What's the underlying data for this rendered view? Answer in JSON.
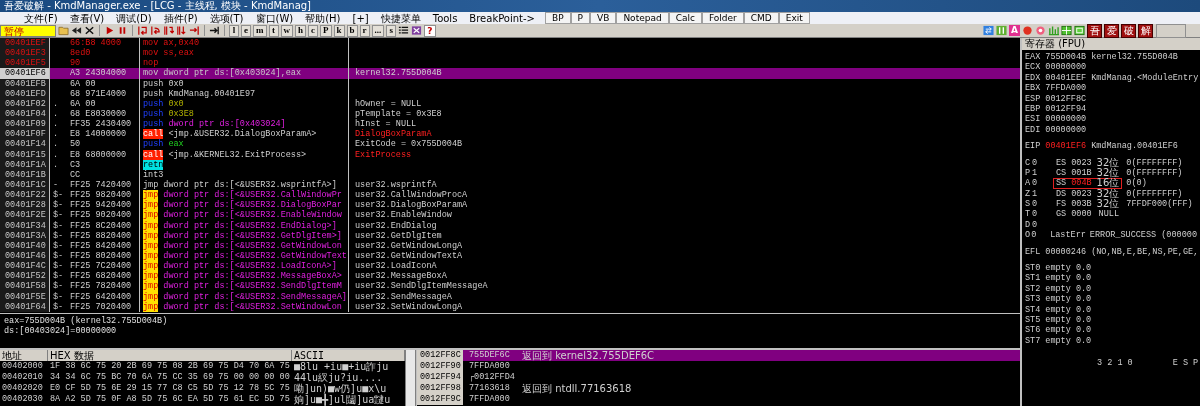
{
  "window": {
    "title": "吾爱破解 - KmdManager.exe - [LCG - 主线程, 模块 - KmdManag]"
  },
  "menu": [
    "文件(F)",
    "查看(V)",
    "调试(D)",
    "插件(P)",
    "选项(T)",
    "窗口(W)",
    "帮助(H)",
    "[+]",
    "快捷菜单",
    "Tools",
    "BreakPoint->"
  ],
  "quick_buttons": [
    "BP",
    "P",
    "VB",
    "Notepad",
    "Calc",
    "Folder",
    "CMD",
    "Exit"
  ],
  "toolbar": {
    "status": "暂停",
    "letters": [
      "l",
      "e",
      "m",
      "t",
      "w",
      "h",
      "c",
      "P",
      "k",
      "b",
      "r",
      "...",
      "s"
    ],
    "help": "?",
    "font_icon": "A",
    "brand": [
      "吾",
      "爱",
      "破",
      "解"
    ]
  },
  "disassembly": [
    {
      "addr": "00401EEF",
      "hex": "66:B8 4000",
      "mnem": "mov",
      "kind": "plain",
      "ops": {
        "text": "ax,0x40",
        "kind": "plain"
      },
      "modified": true,
      "selected": false
    },
    {
      "addr": "00401EF3",
      "hex": "8ed0",
      "mnem": "mov",
      "kind": "plain",
      "ops": {
        "text": "ss,eax",
        "kind": "plain"
      },
      "modified": true,
      "selected": false
    },
    {
      "addr": "00401EF5",
      "hex": "90",
      "mnem": "nop",
      "kind": "plain",
      "modified": true,
      "selected": false
    },
    {
      "addr": "00401EF6",
      "hex": "A3 24304000",
      "mnem": "mov",
      "kind": "plain",
      "ops": {
        "text": "dword ptr ds:[0x403024],eax",
        "kind": "plain"
      },
      "modified": false,
      "selected": true,
      "comment": {
        "text": "kernel32.755D004B",
        "kind": "plain"
      }
    },
    {
      "addr": "00401EFB",
      "hex": "6A 00",
      "mnem": "push",
      "kind": "plain",
      "ops": {
        "text": "0x0",
        "kind": "plain"
      },
      "modified": false,
      "selected": false
    },
    {
      "addr": "00401EFD",
      "hex": "68 971E4000",
      "mnem": "push",
      "kind": "plain",
      "ops": {
        "text": "KmdManag.00401E97",
        "kind": "plain"
      },
      "modified": false,
      "selected": false
    },
    {
      "addr": "00401F02",
      "mark": ".",
      "hex": "6A 00",
      "mnem": "push",
      "kind": "push",
      "ops": {
        "text": "0x0",
        "kind": "imm"
      },
      "modified": false,
      "selected": false,
      "comment": {
        "text": "hOwner = NULL",
        "kind": "plain"
      }
    },
    {
      "addr": "00401F04",
      "mark": ".",
      "hex": "68 E8030000",
      "mnem": "push",
      "kind": "push",
      "ops": {
        "text": "0x3E8",
        "kind": "imm"
      },
      "modified": false,
      "selected": false,
      "comment": {
        "text": "pTemplate = 0x3E8",
        "kind": "plain"
      }
    },
    {
      "addr": "00401F09",
      "mark": ".",
      "hex": "FF35 2430400",
      "mnem": "push",
      "kind": "push",
      "ops": {
        "text": "dword ptr ds:[0x403024]",
        "kind": "mem"
      },
      "modified": false,
      "selected": false,
      "comment": {
        "text": "hInst = NULL",
        "kind": "plain"
      }
    },
    {
      "addr": "00401F0F",
      "mark": ".",
      "hex": "E8 14000000",
      "mnem": "call",
      "kind": "call",
      "ops": {
        "text": "<jmp.&USER32.DialogBoxParamA>",
        "kind": "plain"
      },
      "modified": false,
      "selected": false,
      "comment": {
        "text": "DialogBoxParamA",
        "kind": "api"
      }
    },
    {
      "addr": "00401F14",
      "mark": ".",
      "hex": "50",
      "mnem": "push",
      "kind": "push",
      "ops": {
        "text": "eax",
        "kind": "reg"
      },
      "modified": false,
      "selected": false,
      "comment": {
        "text": "ExitCode = 0x755D004B",
        "kind": "plain"
      }
    },
    {
      "addr": "00401F15",
      "mark": ".",
      "hex": "E8 68000000",
      "mnem": "call",
      "kind": "call",
      "ops": {
        "text": "<jmp.&KERNEL32.ExitProcess>",
        "kind": "plain"
      },
      "modified": false,
      "selected": false,
      "comment": {
        "text": "ExitProcess",
        "kind": "api"
      }
    },
    {
      "addr": "00401F1A",
      "mark": ".",
      "hex": "C3",
      "mnem": "retn",
      "kind": "retn",
      "modified": false,
      "selected": false
    },
    {
      "addr": "00401F1B",
      "hex": "CC",
      "mnem": "int3",
      "kind": "plain",
      "modified": false,
      "selected": false
    },
    {
      "addr": "00401F1C",
      "mark": "-",
      "hex": "FF25 7420400",
      "mnem": "jmp",
      "kind": "plain",
      "ops": {
        "text": "dword ptr ds:[<&USER32.wsprintfA>]",
        "kind": "plain"
      },
      "modified": false,
      "selected": false,
      "comment": {
        "text": "user32.wsprintfA",
        "kind": "plain"
      }
    },
    {
      "addr": "00401F22",
      "mark": "$-",
      "hex": "FF25 9820400",
      "mnem": "jmp",
      "kind": "jmp",
      "ops": {
        "text": "dword ptr ds:[<&USER32.CallWindowPr",
        "kind": "mem"
      },
      "modified": false,
      "selected": false,
      "comment": {
        "text": "user32.CallWindowProcA",
        "kind": "plain"
      }
    },
    {
      "addr": "00401F28",
      "mark": "$-",
      "hex": "FF25 9420400",
      "mnem": "jmp",
      "kind": "jmp",
      "ops": {
        "text": "dword ptr ds:[<&USER32.DialogBoxPar",
        "kind": "mem"
      },
      "modified": false,
      "selected": false,
      "comment": {
        "text": "user32.DialogBoxParamA",
        "kind": "plain"
      }
    },
    {
      "addr": "00401F2E",
      "mark": "$-",
      "hex": "FF25 9020400",
      "mnem": "jmp",
      "kind": "jmp",
      "ops": {
        "text": "dword ptr ds:[<&USER32.EnableWindow",
        "kind": "mem"
      },
      "modified": false,
      "selected": false,
      "comment": {
        "text": "user32.EnableWindow",
        "kind": "plain"
      }
    },
    {
      "addr": "00401F34",
      "mark": "$-",
      "hex": "FF25 8C20400",
      "mnem": "jmp",
      "kind": "jmp",
      "ops": {
        "text": "dword ptr ds:[<&USER32.EndDialog>]",
        "kind": "mem"
      },
      "modified": false,
      "selected": false,
      "comment": {
        "text": "user32.EndDialog",
        "kind": "plain"
      }
    },
    {
      "addr": "00401F3A",
      "mark": "$-",
      "hex": "FF25 8820400",
      "mnem": "jmp",
      "kind": "jmp",
      "ops": {
        "text": "dword ptr ds:[<&USER32.GetDlgItem>]",
        "kind": "mem"
      },
      "modified": false,
      "selected": false,
      "comment": {
        "text": "user32.GetDlgItem",
        "kind": "plain"
      }
    },
    {
      "addr": "00401F40",
      "mark": "$-",
      "hex": "FF25 8420400",
      "mnem": "jmp",
      "kind": "jmp",
      "ops": {
        "text": "dword ptr ds:[<&USER32.GetWindowLon",
        "kind": "mem"
      },
      "modified": false,
      "selected": false,
      "comment": {
        "text": "user32.GetWindowLongA",
        "kind": "plain"
      }
    },
    {
      "addr": "00401F46",
      "mark": "$-",
      "hex": "FF25 8020400",
      "mnem": "jmp",
      "kind": "jmp",
      "ops": {
        "text": "dword ptr ds:[<&USER32.GetWindowText",
        "kind": "mem"
      },
      "modified": false,
      "selected": false,
      "comment": {
        "text": "user32.GetWindowTextA",
        "kind": "plain"
      }
    },
    {
      "addr": "00401F4C",
      "mark": "$-",
      "hex": "FF25 7C20400",
      "mnem": "jmp",
      "kind": "jmp",
      "ops": {
        "text": "dword ptr ds:[<&USER32.LoadIconA>]",
        "kind": "mem"
      },
      "modified": false,
      "selected": false,
      "comment": {
        "text": "user32.LoadIconA",
        "kind": "plain"
      }
    },
    {
      "addr": "00401F52",
      "mark": "$-",
      "hex": "FF25 6820400",
      "mnem": "jmp",
      "kind": "jmp",
      "ops": {
        "text": "dword ptr ds:[<&USER32.MessageBoxA>",
        "kind": "mem"
      },
      "modified": false,
      "selected": false,
      "comment": {
        "text": "user32.MessageBoxA",
        "kind": "plain"
      }
    },
    {
      "addr": "00401F58",
      "mark": "$-",
      "hex": "FF25 7820400",
      "mnem": "jmp",
      "kind": "jmp",
      "ops": {
        "text": "dword ptr ds:[<&USER32.SendDlgItemM",
        "kind": "mem"
      },
      "modified": false,
      "selected": false,
      "comment": {
        "text": "user32.SendDlgItemMessageA",
        "kind": "plain"
      }
    },
    {
      "addr": "00401F5E",
      "mark": "$-",
      "hex": "FF25 6420400",
      "mnem": "jmp",
      "kind": "jmp",
      "ops": {
        "text": "dword ptr ds:[<&USER32.SendMessageA]",
        "kind": "mem"
      },
      "modified": false,
      "selected": false,
      "comment": {
        "text": "user32.SendMessageA",
        "kind": "plain"
      }
    },
    {
      "addr": "00401F64",
      "mark": "$-",
      "hex": "FF25 7020400",
      "mnem": "jmp",
      "kind": "jmp",
      "ops": {
        "text": "dword ptr ds:[<&USER32.SetWindowLon",
        "kind": "mem"
      },
      "modified": false,
      "selected": false,
      "comment": {
        "text": "user32.SetWindowLongA",
        "kind": "plain"
      }
    }
  ],
  "info": [
    "eax=755D004B (kernel32.755D004B)",
    "ds:[00403024]=00000000"
  ],
  "registers": {
    "title": "寄存器 (FPU)",
    "general": [
      {
        "name": "EAX",
        "value": "755D004B",
        "comment": "kernel32.755D004B",
        "changed": false
      },
      {
        "name": "ECX",
        "value": "00000000",
        "changed": false
      },
      {
        "name": "EDX",
        "value": "00401EEF",
        "comment": "KmdManag.<ModuleEntry",
        "changed": false
      },
      {
        "name": "EBX",
        "value": "7FFDA000",
        "changed": false
      },
      {
        "name": "ESP",
        "value": "0012FF8C",
        "changed": false
      },
      {
        "name": "EBP",
        "value": "0012FF94",
        "changed": false
      },
      {
        "name": "ESI",
        "value": "00000000",
        "changed": false
      },
      {
        "name": "EDI",
        "value": "00000000",
        "changed": false
      }
    ],
    "eip": {
      "name": "EIP",
      "value": "00401EF6",
      "comment": "KmdManag.00401EF6",
      "changed": true
    },
    "flags": [
      {
        "flag": "C",
        "bit": "0",
        "kind": "seg",
        "seg": "ES",
        "sel": "0023",
        "size": "32位",
        "base": "0(FFFFFFFF)",
        "changed": false,
        "highlighted": false
      },
      {
        "flag": "P",
        "bit": "1",
        "kind": "seg",
        "seg": "CS",
        "sel": "001B",
        "size": "32位",
        "base": "0(FFFFFFFF)",
        "changed": false,
        "highlighted": false
      },
      {
        "flag": "A",
        "bit": "0",
        "kind": "seg",
        "seg": "SS",
        "sel": "004B",
        "size": "16位",
        "base": "0(0)",
        "changed": true,
        "highlighted": true
      },
      {
        "flag": "Z",
        "bit": "1",
        "kind": "seg",
        "seg": "DS",
        "sel": "0023",
        "size": "32位",
        "base": "0(FFFFFFFF)",
        "changed": false,
        "highlighted": false
      },
      {
        "flag": "S",
        "bit": "0",
        "kind": "seg",
        "seg": "FS",
        "sel": "003B",
        "size": "32位",
        "base": "7FFDF000(FFF)",
        "changed": false,
        "highlighted": false
      },
      {
        "flag": "T",
        "bit": "0",
        "kind": "seg",
        "seg": "GS",
        "sel": "0000",
        "base": "NULL",
        "changed": false,
        "highlighted": false
      },
      {
        "flag": "D",
        "bit": "0",
        "kind": "none"
      },
      {
        "flag": "O",
        "bit": "0",
        "kind": "lasterr",
        "label": "LastErr",
        "value": "ERROR_SUCCESS (000000"
      }
    ],
    "efl": {
      "name": "EFL",
      "value": "00000246",
      "comment": "(NO,NB,E,BE,NS,PE,GE,"
    },
    "fpu": [
      {
        "name": "ST0",
        "value": "empty 0.0"
      },
      {
        "name": "ST1",
        "value": "empty 0.0"
      },
      {
        "name": "ST2",
        "value": "empty 0.0"
      },
      {
        "name": "ST3",
        "value": "empty 0.0"
      },
      {
        "name": "ST4",
        "value": "empty 0.0"
      },
      {
        "name": "ST5",
        "value": "empty 0.0"
      },
      {
        "name": "ST6",
        "value": "empty 0.0"
      },
      {
        "name": "ST7",
        "value": "empty 0.0"
      }
    ],
    "fpu_footer": [
      "3 2 1 0",
      "E S P"
    ]
  },
  "dump": {
    "columns": [
      "地址",
      "HEX 数据",
      "ASCII"
    ],
    "rows": [
      {
        "addr": "00402000",
        "hex": "1F 38 6C 75 20 2B 69 75 08 2B 69 75 D4 70 6A 75",
        "ascii": "■8lu +iu■+iu詐ju"
      },
      {
        "addr": "00402010",
        "hex": "34 34 6C 75 BC 70 6A 75 CC 35 69 75 00 00 00 00",
        "ascii": "44lu紁ju?iu...."
      },
      {
        "addr": "00402020",
        "hex": "E0 CF 5D 75 6E 29 15 77 C8 C5 5D 75 12 78 5C 75",
        "ascii": "嘞]un)■w仍]u■x\\u"
      },
      {
        "addr": "00402030",
        "hex": "8A A2 5D 75 0F A8 5D 75 6C EA 5D 75 61 EC 5D 75",
        "ascii": "姠]u■╋]ul闧]ua靆u"
      }
    ]
  },
  "stack": [
    {
      "addr": "0012FF8C",
      "value": "755DEF6C",
      "comment": "返回到 kernel32.755DEF6C",
      "selected": true
    },
    {
      "addr": "0012FF90",
      "value": "7FFDA000",
      "selected": false
    },
    {
      "addr": "0012FF94",
      "value": "┌0012FFD4",
      "selected": false
    },
    {
      "addr": "0012FF98",
      "value": "77163618",
      "comment": "返回到 ntdll.77163618",
      "selected": false
    },
    {
      "addr": "0012FF9C",
      "value": "7FFDA000",
      "selected": false
    }
  ]
}
